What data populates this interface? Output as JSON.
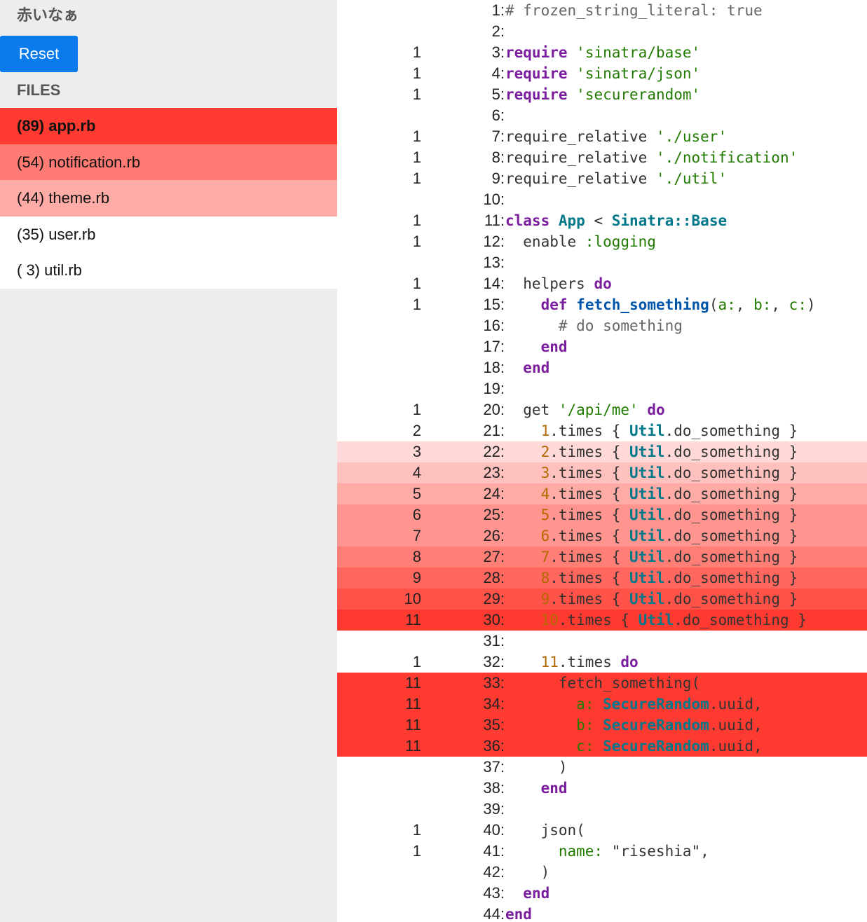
{
  "sidebar": {
    "title": "赤いなぁ",
    "reset_label": "Reset",
    "files_heading": "FILES",
    "files": [
      {
        "label": "(89) app.rb",
        "bg": "#ff3a30",
        "bold": true
      },
      {
        "label": "(54) notification.rb",
        "bg": "#ff7b73",
        "bold": false
      },
      {
        "label": "(44) theme.rb",
        "bg": "#ffaba6",
        "bold": false
      },
      {
        "label": "(35) user.rb",
        "bg": "#ffffff",
        "bold": false
      },
      {
        "label": "( 3) util.rb",
        "bg": "#ffffff",
        "bold": false
      }
    ]
  },
  "colors": {
    "heat_1": "#ffd9d7",
    "heat_2": "#ffc1bd",
    "heat_3": "#ffaba6",
    "heat_4": "#ff958e",
    "heat_5": "#ff7f77",
    "heat_6": "#ff675f",
    "heat_7": "#ff5249",
    "heat_max": "#ff3a30"
  },
  "code": {
    "lines": [
      {
        "n": "1:",
        "c": "",
        "bg": "",
        "tokens": [
          [
            "# frozen_string_literal: true",
            "comment"
          ]
        ]
      },
      {
        "n": "2:",
        "c": "",
        "bg": "",
        "tokens": []
      },
      {
        "n": "3:",
        "c": "1",
        "bg": "",
        "tokens": [
          [
            "require",
            "kw"
          ],
          [
            " ",
            "plain"
          ],
          [
            "'sinatra/base'",
            "str"
          ]
        ]
      },
      {
        "n": "4:",
        "c": "1",
        "bg": "",
        "tokens": [
          [
            "require",
            "kw"
          ],
          [
            " ",
            "plain"
          ],
          [
            "'sinatra/json'",
            "str"
          ]
        ]
      },
      {
        "n": "5:",
        "c": "1",
        "bg": "",
        "tokens": [
          [
            "require",
            "kw"
          ],
          [
            " ",
            "plain"
          ],
          [
            "'securerandom'",
            "str"
          ]
        ]
      },
      {
        "n": "6:",
        "c": "",
        "bg": "",
        "tokens": []
      },
      {
        "n": "7:",
        "c": "1",
        "bg": "",
        "tokens": [
          [
            "require_relative ",
            "plain"
          ],
          [
            "'./user'",
            "str"
          ]
        ]
      },
      {
        "n": "8:",
        "c": "1",
        "bg": "",
        "tokens": [
          [
            "require_relative ",
            "plain"
          ],
          [
            "'./notification'",
            "str"
          ]
        ]
      },
      {
        "n": "9:",
        "c": "1",
        "bg": "",
        "tokens": [
          [
            "require_relative ",
            "plain"
          ],
          [
            "'./util'",
            "str"
          ]
        ]
      },
      {
        "n": "10:",
        "c": "",
        "bg": "",
        "tokens": []
      },
      {
        "n": "11:",
        "c": "1",
        "bg": "",
        "tokens": [
          [
            "class",
            "kw"
          ],
          [
            " ",
            "plain"
          ],
          [
            "App",
            "const"
          ],
          [
            " < ",
            "plain"
          ],
          [
            "Sinatra::Base",
            "const"
          ]
        ]
      },
      {
        "n": "12:",
        "c": "1",
        "bg": "",
        "tokens": [
          [
            "  enable ",
            "plain"
          ],
          [
            ":logging",
            "sym"
          ]
        ]
      },
      {
        "n": "13:",
        "c": "",
        "bg": "",
        "tokens": []
      },
      {
        "n": "14:",
        "c": "1",
        "bg": "",
        "tokens": [
          [
            "  helpers ",
            "plain"
          ],
          [
            "do",
            "kw"
          ]
        ]
      },
      {
        "n": "15:",
        "c": "1",
        "bg": "",
        "tokens": [
          [
            "    ",
            "plain"
          ],
          [
            "def",
            "kw"
          ],
          [
            " ",
            "plain"
          ],
          [
            "fetch_something",
            "method"
          ],
          [
            "(",
            "plain"
          ],
          [
            "a:",
            "key"
          ],
          [
            ", ",
            "plain"
          ],
          [
            "b:",
            "key"
          ],
          [
            ", ",
            "plain"
          ],
          [
            "c:",
            "key"
          ],
          [
            ")",
            "plain"
          ]
        ]
      },
      {
        "n": "16:",
        "c": "",
        "bg": "",
        "tokens": [
          [
            "      # do something",
            "comment"
          ]
        ]
      },
      {
        "n": "17:",
        "c": "",
        "bg": "",
        "tokens": [
          [
            "    ",
            "plain"
          ],
          [
            "end",
            "kw"
          ]
        ]
      },
      {
        "n": "18:",
        "c": "",
        "bg": "",
        "tokens": [
          [
            "  ",
            "plain"
          ],
          [
            "end",
            "kw"
          ]
        ]
      },
      {
        "n": "19:",
        "c": "",
        "bg": "",
        "tokens": []
      },
      {
        "n": "20:",
        "c": "1",
        "bg": "",
        "tokens": [
          [
            "  get ",
            "plain"
          ],
          [
            "'/api/me'",
            "str"
          ],
          [
            " ",
            "plain"
          ],
          [
            "do",
            "kw"
          ]
        ]
      },
      {
        "n": "21:",
        "c": "2",
        "bg": "",
        "tokens": [
          [
            "    ",
            "plain"
          ],
          [
            "1",
            "num"
          ],
          [
            ".times { ",
            "plain"
          ],
          [
            "Util",
            "const"
          ],
          [
            ".do_something }",
            "plain"
          ]
        ]
      },
      {
        "n": "22:",
        "c": "3",
        "bg": "heat_1",
        "tokens": [
          [
            "    ",
            "plain"
          ],
          [
            "2",
            "num"
          ],
          [
            ".times { ",
            "plain"
          ],
          [
            "Util",
            "const"
          ],
          [
            ".do_something }",
            "plain"
          ]
        ]
      },
      {
        "n": "23:",
        "c": "4",
        "bg": "heat_2",
        "tokens": [
          [
            "    ",
            "plain"
          ],
          [
            "3",
            "num"
          ],
          [
            ".times { ",
            "plain"
          ],
          [
            "Util",
            "const"
          ],
          [
            ".do_something }",
            "plain"
          ]
        ]
      },
      {
        "n": "24:",
        "c": "5",
        "bg": "heat_3",
        "tokens": [
          [
            "    ",
            "plain"
          ],
          [
            "4",
            "num"
          ],
          [
            ".times { ",
            "plain"
          ],
          [
            "Util",
            "const"
          ],
          [
            ".do_something }",
            "plain"
          ]
        ]
      },
      {
        "n": "25:",
        "c": "6",
        "bg": "heat_4",
        "tokens": [
          [
            "    ",
            "plain"
          ],
          [
            "5",
            "num"
          ],
          [
            ".times { ",
            "plain"
          ],
          [
            "Util",
            "const"
          ],
          [
            ".do_something }",
            "plain"
          ]
        ]
      },
      {
        "n": "26:",
        "c": "7",
        "bg": "heat_4",
        "tokens": [
          [
            "    ",
            "plain"
          ],
          [
            "6",
            "num"
          ],
          [
            ".times { ",
            "plain"
          ],
          [
            "Util",
            "const"
          ],
          [
            ".do_something }",
            "plain"
          ]
        ]
      },
      {
        "n": "27:",
        "c": "8",
        "bg": "heat_5",
        "tokens": [
          [
            "    ",
            "plain"
          ],
          [
            "7",
            "num"
          ],
          [
            ".times { ",
            "plain"
          ],
          [
            "Util",
            "const"
          ],
          [
            ".do_something }",
            "plain"
          ]
        ]
      },
      {
        "n": "28:",
        "c": "9",
        "bg": "heat_6",
        "tokens": [
          [
            "    ",
            "plain"
          ],
          [
            "8",
            "num"
          ],
          [
            ".times { ",
            "plain"
          ],
          [
            "Util",
            "const"
          ],
          [
            ".do_something }",
            "plain"
          ]
        ]
      },
      {
        "n": "29:",
        "c": "10",
        "bg": "heat_7",
        "tokens": [
          [
            "    ",
            "plain"
          ],
          [
            "9",
            "num"
          ],
          [
            ".times { ",
            "plain"
          ],
          [
            "Util",
            "const"
          ],
          [
            ".do_something }",
            "plain"
          ]
        ]
      },
      {
        "n": "30:",
        "c": "11",
        "bg": "heat_max",
        "tokens": [
          [
            "    ",
            "plain"
          ],
          [
            "10",
            "num"
          ],
          [
            ".times { ",
            "plain"
          ],
          [
            "Util",
            "const"
          ],
          [
            ".do_something }",
            "plain"
          ]
        ]
      },
      {
        "n": "31:",
        "c": "",
        "bg": "",
        "tokens": []
      },
      {
        "n": "32:",
        "c": "1",
        "bg": "",
        "tokens": [
          [
            "    ",
            "plain"
          ],
          [
            "11",
            "num"
          ],
          [
            ".times ",
            "plain"
          ],
          [
            "do",
            "kw"
          ]
        ]
      },
      {
        "n": "33:",
        "c": "11",
        "bg": "heat_max",
        "tokens": [
          [
            "      fetch_something(",
            "plain"
          ]
        ]
      },
      {
        "n": "34:",
        "c": "11",
        "bg": "heat_max",
        "tokens": [
          [
            "        ",
            "plain"
          ],
          [
            "a:",
            "key"
          ],
          [
            " ",
            "plain"
          ],
          [
            "SecureRandom",
            "const"
          ],
          [
            ".uuid,",
            "plain"
          ]
        ]
      },
      {
        "n": "35:",
        "c": "11",
        "bg": "heat_max",
        "tokens": [
          [
            "        ",
            "plain"
          ],
          [
            "b:",
            "key"
          ],
          [
            " ",
            "plain"
          ],
          [
            "SecureRandom",
            "const"
          ],
          [
            ".uuid,",
            "plain"
          ]
        ]
      },
      {
        "n": "36:",
        "c": "11",
        "bg": "heat_max",
        "tokens": [
          [
            "        ",
            "plain"
          ],
          [
            "c:",
            "key"
          ],
          [
            " ",
            "plain"
          ],
          [
            "SecureRandom",
            "const"
          ],
          [
            ".uuid,",
            "plain"
          ]
        ]
      },
      {
        "n": "37:",
        "c": "",
        "bg": "",
        "tokens": [
          [
            "      )",
            "plain"
          ]
        ]
      },
      {
        "n": "38:",
        "c": "",
        "bg": "",
        "tokens": [
          [
            "    ",
            "plain"
          ],
          [
            "end",
            "kw"
          ]
        ]
      },
      {
        "n": "39:",
        "c": "",
        "bg": "",
        "tokens": []
      },
      {
        "n": "40:",
        "c": "1",
        "bg": "",
        "tokens": [
          [
            "    json(",
            "plain"
          ]
        ]
      },
      {
        "n": "41:",
        "c": "1",
        "bg": "",
        "tokens": [
          [
            "      ",
            "plain"
          ],
          [
            "name:",
            "key"
          ],
          [
            " \"riseshia\",",
            "plain"
          ]
        ]
      },
      {
        "n": "42:",
        "c": "",
        "bg": "",
        "tokens": [
          [
            "    )",
            "plain"
          ]
        ]
      },
      {
        "n": "43:",
        "c": "",
        "bg": "",
        "tokens": [
          [
            "  ",
            "plain"
          ],
          [
            "end",
            "kw"
          ]
        ]
      },
      {
        "n": "44:",
        "c": "",
        "bg": "",
        "tokens": [
          [
            "end",
            "kw"
          ]
        ]
      }
    ]
  }
}
